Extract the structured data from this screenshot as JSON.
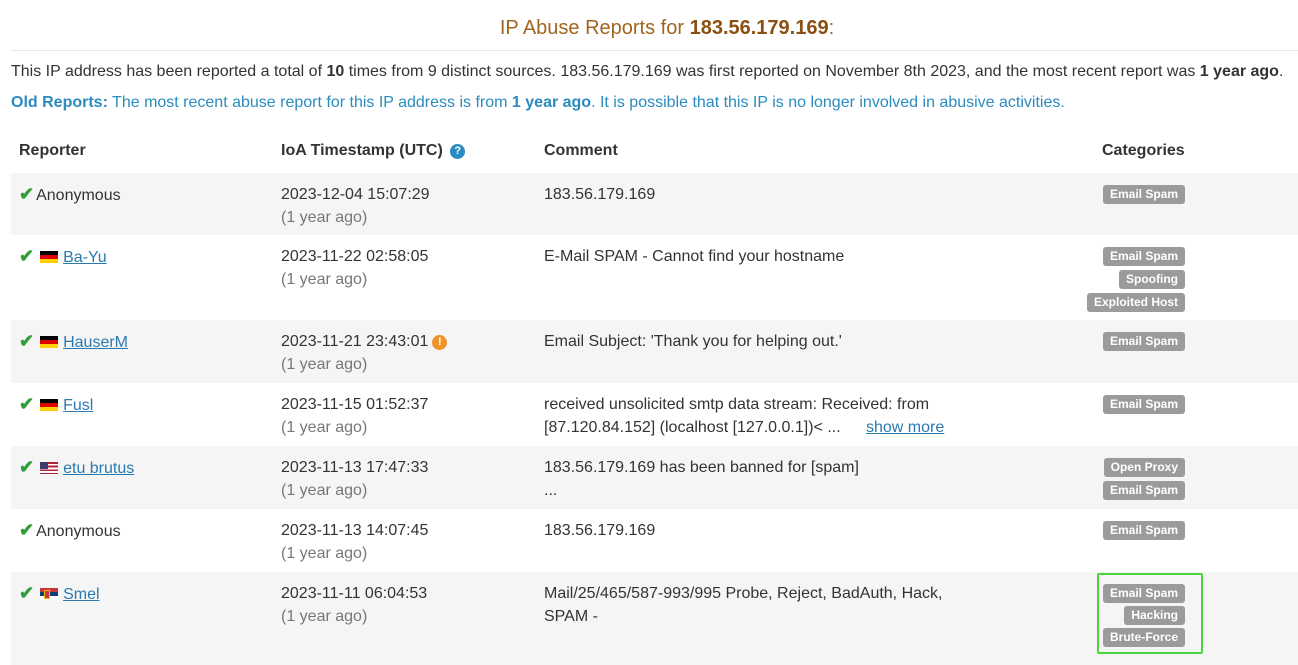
{
  "header": {
    "title_prefix": "IP Abuse Reports for ",
    "ip": "183.56.179.169",
    "title_suffix": ":"
  },
  "summary": {
    "part1": "This IP address has been reported a total of ",
    "count": "10",
    "part2": " times from 9 distinct sources. 183.56.179.169 was first reported on November 8th 2023, and the most recent report was ",
    "recent": "1 year ago",
    "part3": "."
  },
  "old_reports": {
    "lead": "Old Reports:",
    "text1": " The most recent abuse report for this IP address is from ",
    "age": "1 year ago",
    "text2": ". It is possible that this IP is no longer involved in abusive activities."
  },
  "table": {
    "headers": {
      "reporter": "Reporter",
      "timestamp": "IoA Timestamp (UTC)",
      "comment": "Comment",
      "categories": "Categories"
    },
    "show_more_label": "show more",
    "rows": [
      {
        "reporter": "Anonymous",
        "flag": "",
        "timestamp": "2023-12-04 15:07:29",
        "ago": "(1 year ago)",
        "comment_line1": "183.56.179.169",
        "comment_line2": "",
        "categories": [
          "Email Spam"
        ]
      },
      {
        "reporter": "Ba-Yu",
        "flag": "germany-flag-icon",
        "timestamp": "2023-11-22 02:58:05",
        "ago": "(1 year ago)",
        "comment_line1": "E-Mail SPAM - Cannot find your hostname",
        "comment_line2": "",
        "categories": [
          "Email Spam",
          "Spoofing",
          "Exploited Host"
        ]
      },
      {
        "reporter": "HauserM",
        "flag": "germany-flag-icon",
        "timestamp": "2023-11-21 23:43:01",
        "ago": "(1 year ago)",
        "comment_line1": "Email Subject: 'Thank you for helping out.'",
        "comment_line2": "",
        "categories": [
          "Email Spam"
        ]
      },
      {
        "reporter": "Fusl",
        "flag": "germany-flag-icon",
        "timestamp": "2023-11-15 01:52:37",
        "ago": "(1 year ago)",
        "comment_line1": "received unsolicited smtp data stream: Received: from",
        "comment_line2": "[87.120.84.152] (localhost [127.0.0.1])< ...",
        "categories": [
          "Email Spam"
        ]
      },
      {
        "reporter": "etu brutus",
        "flag": "usa-flag-icon",
        "timestamp": "2023-11-13 17:47:33",
        "ago": "(1 year ago)",
        "comment_line1": "183.56.179.169 has been banned for [spam]",
        "comment_line2": "...",
        "categories": [
          "Open Proxy",
          "Email Spam"
        ]
      },
      {
        "reporter": "Anonymous",
        "flag": "",
        "timestamp": "2023-11-13 14:07:45",
        "ago": "(1 year ago)",
        "comment_line1": "183.56.179.169",
        "comment_line2": "",
        "categories": [
          "Email Spam"
        ]
      },
      {
        "reporter": "Smel",
        "flag": "serbia-flag-icon",
        "timestamp": "2023-11-11 06:04:53",
        "ago": "(1 year ago)",
        "comment_line1": "Mail/25/465/587-993/995 Probe, Reject, BadAuth, Hack,",
        "comment_line2": "SPAM -",
        "categories": [
          "Email Spam",
          "Hacking",
          "Brute-Force"
        ]
      }
    ]
  },
  "colors": {
    "title": "#a0651e",
    "link": "#2a7ab0",
    "info_text": "#2a8bbf",
    "badge_bg": "#9b9b9b",
    "check": "#2e9e3b",
    "warning": "#f0932b",
    "highlight_border": "#4cd43c",
    "row_alt_bg": "#f5f5f5"
  }
}
